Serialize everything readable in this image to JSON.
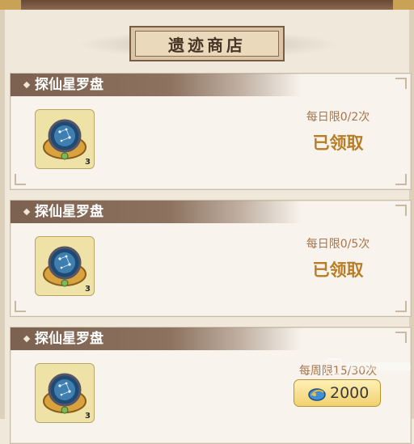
{
  "header": {
    "title": "遗迹商店"
  },
  "items": [
    {
      "name": "探仙星罗盘",
      "count": "3",
      "limit": "每日限0/2次",
      "status": "已领取"
    },
    {
      "name": "探仙星罗盘",
      "count": "3",
      "limit": "每日限0/5次",
      "status": "已领取"
    },
    {
      "name": "探仙星罗盘",
      "count": "3",
      "limit": "每周限15/30次",
      "price": "2000"
    }
  ],
  "icons": {
    "compass": "star-compass-icon",
    "currency": "feather-coin-icon"
  },
  "colors": {
    "header_bar": "#7c6151",
    "status": "#b77c24",
    "limit": "#a6754c",
    "price_button": "#f2d170"
  }
}
